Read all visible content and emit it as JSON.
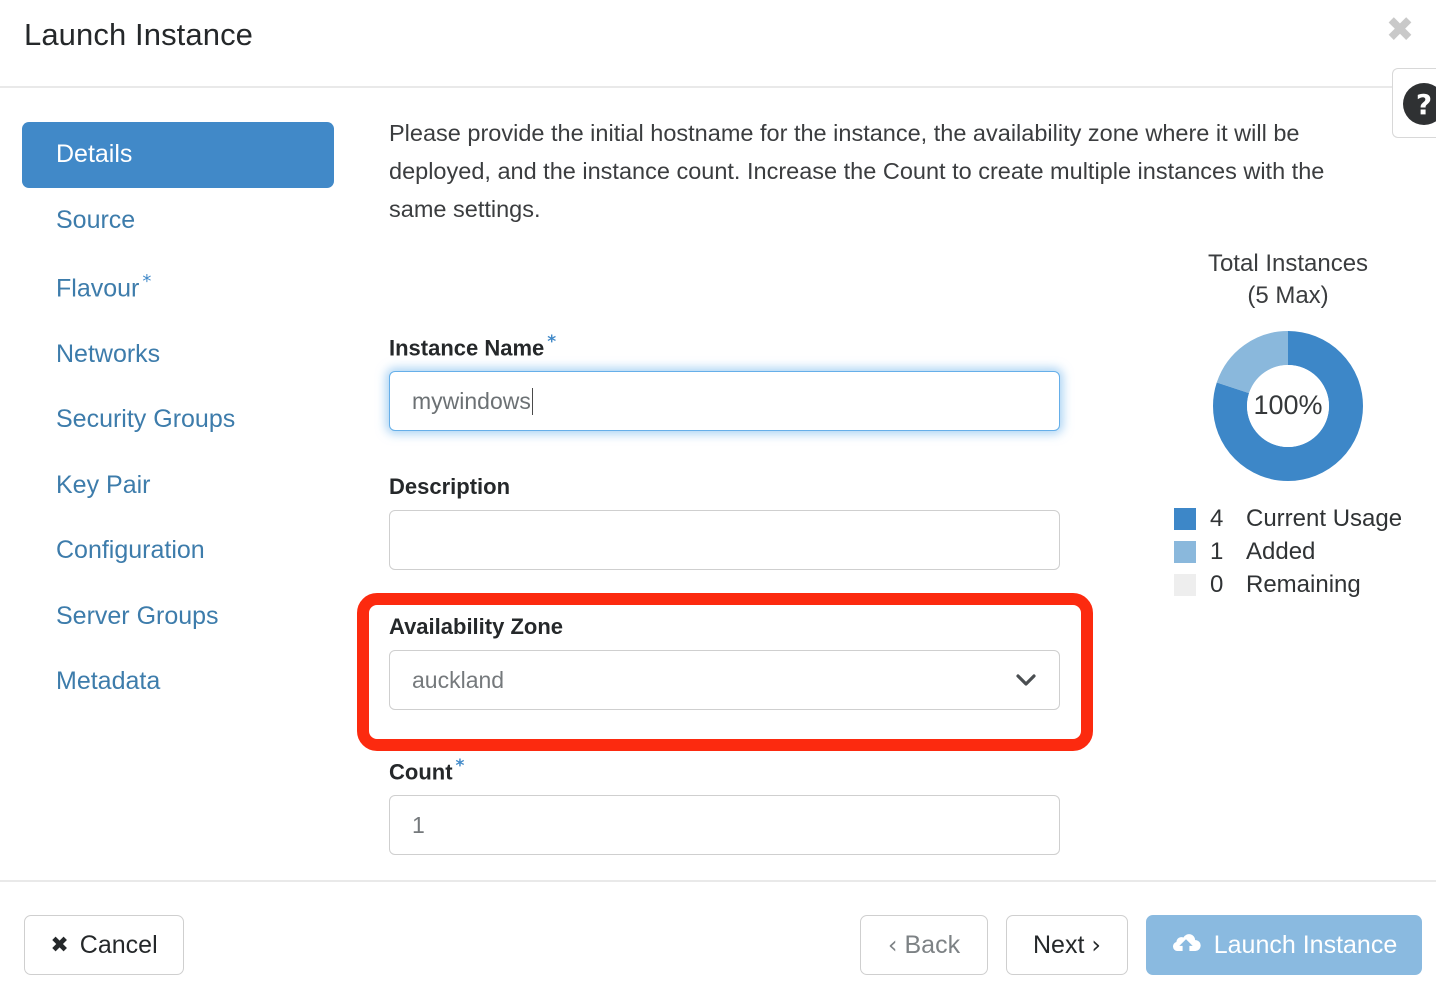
{
  "header": {
    "title": "Launch Instance",
    "close_icon": "close-icon",
    "help_icon": "question-mark-icon",
    "help_label": "?"
  },
  "sidebar": {
    "items": [
      {
        "label": "Details",
        "required": false,
        "active": true
      },
      {
        "label": "Source",
        "required": false,
        "active": false
      },
      {
        "label": "Flavour",
        "required": true,
        "active": false
      },
      {
        "label": "Networks",
        "required": false,
        "active": false
      },
      {
        "label": "Security Groups",
        "required": false,
        "active": false
      },
      {
        "label": "Key Pair",
        "required": false,
        "active": false
      },
      {
        "label": "Configuration",
        "required": false,
        "active": false
      },
      {
        "label": "Server Groups",
        "required": false,
        "active": false
      },
      {
        "label": "Metadata",
        "required": false,
        "active": false
      }
    ],
    "required_marker": "*"
  },
  "main": {
    "intro": "Please provide the initial hostname for the instance, the availability zone where it will be deployed, and the instance count. Increase the Count to create multiple instances with the same settings.",
    "fields": {
      "instance_name": {
        "label": "Instance Name",
        "required_marker": "*",
        "value": "mywindows",
        "placeholder": "",
        "focused": true
      },
      "description": {
        "label": "Description",
        "required_marker": "",
        "value": "",
        "placeholder": ""
      },
      "availability_zone": {
        "label": "Availability Zone",
        "required_marker": "",
        "value": "auckland",
        "chevron_icon": "chevron-down-icon",
        "options": [
          "auckland"
        ]
      },
      "count": {
        "label": "Count",
        "required_marker": "*",
        "value": "1",
        "placeholder": "1"
      }
    },
    "highlight": {
      "color": "#fc2a0f",
      "target": "availability-zone"
    }
  },
  "quota": {
    "title_line1": "Total Instances",
    "title_line2": "(5 Max)",
    "percent_label": "100%",
    "legend": [
      {
        "count": "4",
        "label": "Current Usage",
        "color": "#3d87c8"
      },
      {
        "count": "1",
        "label": "Added",
        "color": "#8ab8dc"
      },
      {
        "count": "0",
        "label": "Remaining",
        "color": "#eeeeee"
      }
    ]
  },
  "chart_data": {
    "type": "pie",
    "title": "Total Instances (5 Max)",
    "center_label": "100%",
    "max": 5,
    "categories": [
      "Current Usage",
      "Added",
      "Remaining"
    ],
    "values": [
      4,
      1,
      0
    ],
    "colors": [
      "#3d87c8",
      "#8ab8dc",
      "#eeeeee"
    ],
    "legend_position": "bottom",
    "donut": true,
    "inner_radius_ratio": 0.55
  },
  "footer": {
    "cancel": {
      "label": "Cancel",
      "icon": "close-x-icon"
    },
    "back": {
      "label": "Back",
      "icon": "chevron-left-icon",
      "disabled": true
    },
    "next": {
      "label": "Next",
      "icon": "chevron-right-icon"
    },
    "launch": {
      "label": "Launch Instance",
      "icon": "cloud-upload-icon",
      "color": "#8abae0"
    }
  }
}
